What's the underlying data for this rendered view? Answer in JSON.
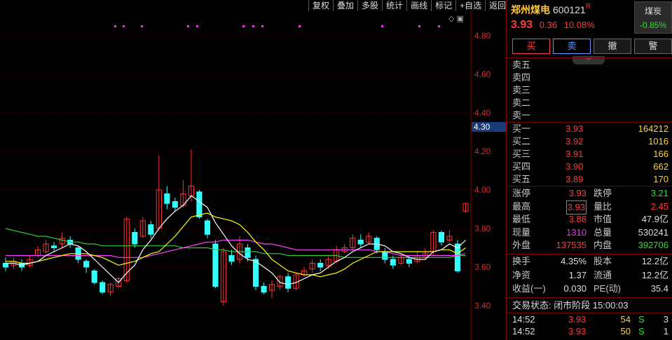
{
  "toolbar": {
    "items": [
      "复权",
      "叠加",
      "多股",
      "统计",
      "画线",
      "标记",
      "+自选",
      "返回"
    ]
  },
  "chart": {
    "y_axis_labels": [
      "4.80",
      "4.60",
      "4.40",
      "4.20",
      "4.00",
      "3.80",
      "3.60",
      "3.40"
    ],
    "current_price_tag": "4.30",
    "colors": {
      "up": "#ff3333",
      "down": "#33ffff",
      "ma5": "#ffffff",
      "ma10": "#ffff00",
      "ma20": "#ff40ff",
      "ma60": "#33cc33",
      "grid": "#6a0000"
    }
  },
  "chart_data": {
    "type": "candlestick",
    "y_range": [
      3.35,
      4.9
    ],
    "candles": [
      [
        3.62,
        3.6,
        3.65,
        3.58
      ],
      [
        3.61,
        3.63,
        3.65,
        3.59
      ],
      [
        3.62,
        3.6,
        3.64,
        3.58
      ],
      [
        3.61,
        3.64,
        3.66,
        3.6
      ],
      [
        3.66,
        3.69,
        3.71,
        3.65
      ],
      [
        3.68,
        3.72,
        3.74,
        3.67
      ],
      [
        3.71,
        3.7,
        3.73,
        3.68
      ],
      [
        3.72,
        3.75,
        3.78,
        3.7
      ],
      [
        3.74,
        3.72,
        3.76,
        3.7
      ],
      [
        3.7,
        3.64,
        3.71,
        3.62
      ],
      [
        3.63,
        3.6,
        3.64,
        3.57
      ],
      [
        3.58,
        3.52,
        3.59,
        3.51
      ],
      [
        3.52,
        3.47,
        3.53,
        3.46
      ],
      [
        3.47,
        3.51,
        3.52,
        3.45
      ],
      [
        3.5,
        3.54,
        3.55,
        3.49
      ],
      [
        3.53,
        3.85,
        3.86,
        3.52
      ],
      [
        3.78,
        3.72,
        3.8,
        3.7
      ],
      [
        3.76,
        3.84,
        3.86,
        3.75
      ],
      [
        3.82,
        3.77,
        3.84,
        3.75
      ],
      [
        3.8,
        4.0,
        4.18,
        3.79
      ],
      [
        3.98,
        3.93,
        4.02,
        3.9
      ],
      [
        3.94,
        3.91,
        3.96,
        3.89
      ],
      [
        3.92,
        3.98,
        4.05,
        3.91
      ],
      [
        3.97,
        4.02,
        4.21,
        3.94
      ],
      [
        3.99,
        3.86,
        4.0,
        3.85
      ],
      [
        3.84,
        3.77,
        3.85,
        3.75
      ],
      [
        3.72,
        3.5,
        3.74,
        3.49
      ],
      [
        3.42,
        3.68,
        3.7,
        3.4
      ],
      [
        3.66,
        3.63,
        3.69,
        3.61
      ],
      [
        3.64,
        3.72,
        3.76,
        3.62
      ],
      [
        3.7,
        3.65,
        3.72,
        3.63
      ],
      [
        3.64,
        3.5,
        3.66,
        3.48
      ],
      [
        3.5,
        3.47,
        3.52,
        3.46
      ],
      [
        3.48,
        3.51,
        3.53,
        3.44
      ],
      [
        3.5,
        3.55,
        3.56,
        3.48
      ],
      [
        3.55,
        3.49,
        3.57,
        3.47
      ],
      [
        3.49,
        3.56,
        3.57,
        3.48
      ],
      [
        3.56,
        3.58,
        3.6,
        3.55
      ],
      [
        3.59,
        3.62,
        3.64,
        3.57
      ],
      [
        3.62,
        3.6,
        3.64,
        3.58
      ],
      [
        3.61,
        3.64,
        3.66,
        3.59
      ],
      [
        3.63,
        3.69,
        3.71,
        3.62
      ],
      [
        3.68,
        3.7,
        3.72,
        3.67
      ],
      [
        3.7,
        3.75,
        3.77,
        3.69
      ],
      [
        3.74,
        3.72,
        3.77,
        3.7
      ],
      [
        3.73,
        3.76,
        3.78,
        3.72
      ],
      [
        3.75,
        3.69,
        3.76,
        3.67
      ],
      [
        3.68,
        3.64,
        3.7,
        3.62
      ],
      [
        3.64,
        3.61,
        3.66,
        3.59
      ],
      [
        3.62,
        3.65,
        3.67,
        3.61
      ],
      [
        3.64,
        3.62,
        3.66,
        3.6
      ],
      [
        3.63,
        3.66,
        3.68,
        3.62
      ],
      [
        3.65,
        3.67,
        3.7,
        3.64
      ],
      [
        3.68,
        3.78,
        3.79,
        3.66
      ],
      [
        3.78,
        3.73,
        3.79,
        3.71
      ],
      [
        3.74,
        3.76,
        3.79,
        3.73
      ],
      [
        3.72,
        3.58,
        3.74,
        3.57
      ],
      [
        3.89,
        3.93,
        3.93,
        3.88
      ]
    ],
    "ma5": [
      3.62,
      3.62,
      3.61,
      3.62,
      3.63,
      3.66,
      3.68,
      3.7,
      3.72,
      3.71,
      3.68,
      3.64,
      3.6,
      3.56,
      3.52,
      3.57,
      3.61,
      3.69,
      3.74,
      3.8,
      3.85,
      3.89,
      3.92,
      3.97,
      3.94,
      3.91,
      3.83,
      3.77,
      3.71,
      3.67,
      3.64,
      3.63,
      3.6,
      3.57,
      3.52,
      3.51,
      3.52,
      3.54,
      3.56,
      3.57,
      3.6,
      3.63,
      3.65,
      3.68,
      3.7,
      3.72,
      3.72,
      3.71,
      3.68,
      3.67,
      3.65,
      3.64,
      3.64,
      3.68,
      3.69,
      3.72,
      3.7,
      3.74
    ],
    "ma10": [
      3.63,
      3.63,
      3.62,
      3.62,
      3.63,
      3.64,
      3.65,
      3.66,
      3.67,
      3.67,
      3.67,
      3.66,
      3.65,
      3.63,
      3.61,
      3.62,
      3.63,
      3.65,
      3.67,
      3.68,
      3.72,
      3.76,
      3.81,
      3.86,
      3.87,
      3.88,
      3.86,
      3.85,
      3.84,
      3.82,
      3.78,
      3.73,
      3.69,
      3.64,
      3.61,
      3.58,
      3.57,
      3.56,
      3.56,
      3.55,
      3.56,
      3.57,
      3.59,
      3.62,
      3.64,
      3.66,
      3.68,
      3.68,
      3.68,
      3.68,
      3.68,
      3.68,
      3.68,
      3.68,
      3.69,
      3.69,
      3.67,
      3.7
    ],
    "ma20": [
      3.66,
      3.66,
      3.66,
      3.66,
      3.66,
      3.66,
      3.66,
      3.66,
      3.66,
      3.66,
      3.66,
      3.66,
      3.66,
      3.66,
      3.65,
      3.65,
      3.65,
      3.65,
      3.66,
      3.67,
      3.68,
      3.69,
      3.7,
      3.71,
      3.72,
      3.73,
      3.73,
      3.74,
      3.74,
      3.74,
      3.74,
      3.73,
      3.72,
      3.72,
      3.71,
      3.7,
      3.69,
      3.69,
      3.69,
      3.69,
      3.69,
      3.69,
      3.69,
      3.69,
      3.69,
      3.69,
      3.68,
      3.68,
      3.67,
      3.66,
      3.66,
      3.66,
      3.66,
      3.66,
      3.66,
      3.66,
      3.66,
      3.67
    ],
    "ma60": [
      3.8,
      3.79,
      3.78,
      3.77,
      3.76,
      3.76,
      3.75,
      3.74,
      3.73,
      3.73,
      3.72,
      3.72,
      3.71,
      3.71,
      3.71,
      3.71,
      3.71,
      3.71,
      3.71,
      3.71,
      3.71,
      3.71,
      3.7,
      3.7,
      3.7,
      3.7,
      3.69,
      3.69,
      3.68,
      3.68,
      3.68,
      3.68,
      3.67,
      3.67,
      3.67,
      3.66,
      3.66,
      3.66,
      3.66,
      3.66,
      3.66,
      3.66,
      3.65,
      3.65,
      3.65,
      3.65,
      3.65,
      3.65,
      3.65,
      3.65,
      3.65,
      3.65,
      3.65,
      3.65,
      3.65,
      3.65,
      3.66,
      3.66
    ]
  },
  "panel": {
    "stock_name": "郑州煤电",
    "stock_code": "600121",
    "badge": "R",
    "price": "3.93",
    "change": "0.36",
    "change_pct": "10.08%",
    "sector_name": "煤炭",
    "sector_change": "-0.85%",
    "buttons": {
      "buy": "买",
      "sell": "卖",
      "cancel": "撤",
      "alert": "警"
    },
    "collapse_icon": "chevron-down",
    "asks": [
      {
        "label": "卖五",
        "price": "",
        "vol": ""
      },
      {
        "label": "卖四",
        "price": "",
        "vol": ""
      },
      {
        "label": "卖三",
        "price": "",
        "vol": ""
      },
      {
        "label": "卖二",
        "price": "",
        "vol": ""
      },
      {
        "label": "卖一",
        "price": "",
        "vol": ""
      }
    ],
    "bids": [
      {
        "label": "买一",
        "price": "3.93",
        "vol": "164212"
      },
      {
        "label": "买二",
        "price": "3.92",
        "vol": "1016"
      },
      {
        "label": "买三",
        "price": "3.91",
        "vol": "166"
      },
      {
        "label": "买四",
        "price": "3.90",
        "vol": "662"
      },
      {
        "label": "买五",
        "price": "3.89",
        "vol": "170"
      }
    ],
    "stats": [
      {
        "l1": "涨停",
        "v1": "3.93",
        "c1": "red",
        "l2": "跌停",
        "v2": "3.21",
        "c2": "green"
      },
      {
        "l1": "最高",
        "v1": "3.93",
        "c1": "red",
        "l2": "量比",
        "v2": "2.45",
        "c2": "red"
      },
      {
        "l1": "最低",
        "v1": "3.88",
        "c1": "red",
        "l2": "市值",
        "v2": "47.9亿",
        "c2": "white"
      },
      {
        "l1": "现量",
        "v1": "1310",
        "c1": "magenta",
        "l2": "总量",
        "v2": "530241",
        "c2": "white"
      },
      {
        "l1": "外盘",
        "v1": "137535",
        "c1": "red",
        "l2": "内盘",
        "v2": "392706",
        "c2": "green"
      }
    ],
    "stats2": [
      {
        "l1": "换手",
        "v1": "4.35%",
        "l2": "股本",
        "v2": "12.2亿"
      },
      {
        "l1": "净资",
        "v1": "1.37",
        "l2": "流通",
        "v2": "12.2亿"
      },
      {
        "l1": "收益(一)",
        "v1": "0.030",
        "l2": "PE(动)",
        "v2": "35.4"
      }
    ],
    "trade_status": "交易状态: 闭市阶段 15:00:03",
    "ticks": [
      {
        "time": "14:52",
        "price": "3.93",
        "vol": "54",
        "side": "S",
        "num": "3"
      },
      {
        "time": "14:52",
        "price": "3.93",
        "vol": "50",
        "side": "S",
        "num": "1"
      }
    ]
  }
}
